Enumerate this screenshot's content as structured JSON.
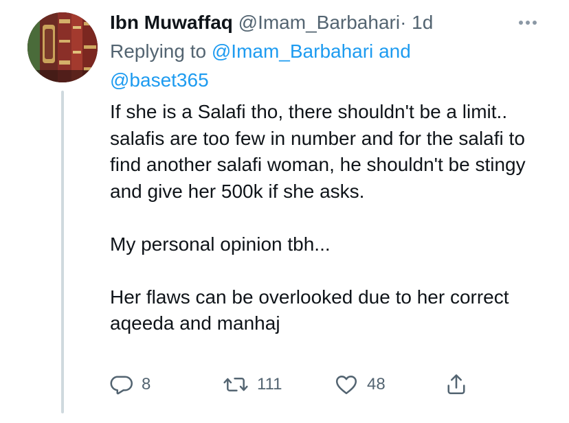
{
  "tweet": {
    "author_name": "Ibn Muwaffaq",
    "author_handle": "@Imam_Barbahari",
    "separator": "·",
    "time": "1d",
    "replying_prefix": "Replying to",
    "replying_mention_1": "@Imam_Barbahari",
    "replying_and": "and",
    "replying_mention_2": "@baset365",
    "body_paragraphs": [
      "If she is a Salafi tho, there shouldn't be a limit.. salafis are too few in number and for the salafi to find another salafi woman, he shouldn't be stingy and give her 500k if she asks.",
      "My personal opinion tbh...",
      "Her flaws can be overlooked due to her correct aqeeda and manhaj"
    ]
  },
  "actions": {
    "reply_count": "8",
    "retweet_count": "111",
    "like_count": "48",
    "reply_icon": "comment-icon",
    "retweet_icon": "retweet-icon",
    "like_icon": "heart-icon",
    "share_icon": "share-icon"
  },
  "colors": {
    "text": "#0f1419",
    "secondary": "#536471",
    "link": "#1d9bf0",
    "thread_line": "#cfd9de"
  }
}
